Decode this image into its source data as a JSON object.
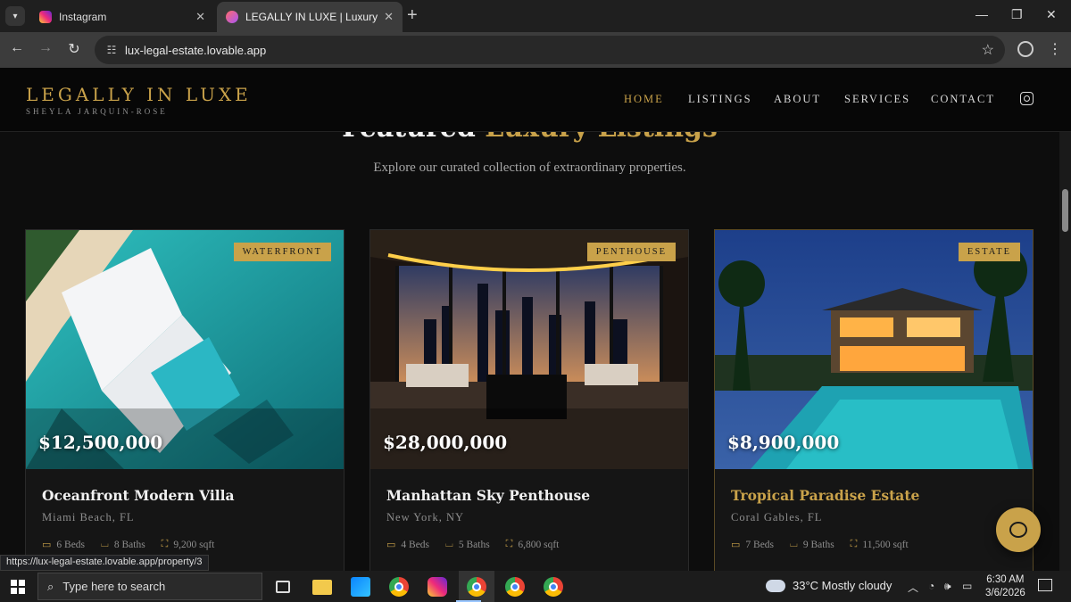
{
  "browser": {
    "tabs": [
      {
        "title": "Instagram",
        "active": false
      },
      {
        "title": "LEGALLY IN LUXE | Luxury Real I",
        "active": true
      }
    ],
    "url": "lux-legal-estate.lovable.app",
    "status_url": "https://lux-legal-estate.lovable.app/property/3"
  },
  "site": {
    "brand_title": "LEGALLY IN LUXE",
    "brand_subtitle": "SHEYLA JARQUIN-ROSE",
    "nav": [
      "HOME",
      "LISTINGS",
      "ABOUT",
      "SERVICES",
      "CONTACT"
    ],
    "active_nav": "HOME",
    "accent_color": "#c9a24a"
  },
  "section": {
    "title_main": "Featured",
    "title_accent": "Luxury Listings",
    "subtitle": "Explore our curated collection of extraordinary properties."
  },
  "listings": [
    {
      "badge": "WATERFRONT",
      "price": "$12,500,000",
      "name": "Oceanfront Modern Villa",
      "location": "Miami Beach, FL",
      "beds": "6 Beds",
      "baths": "8 Baths",
      "sqft": "9,200 sqft"
    },
    {
      "badge": "PENTHOUSE",
      "price": "$28,000,000",
      "name": "Manhattan Sky Penthouse",
      "location": "New York, NY",
      "beds": "4 Beds",
      "baths": "5 Baths",
      "sqft": "6,800 sqft"
    },
    {
      "badge": "ESTATE",
      "price": "$8,900,000",
      "name": "Tropical Paradise Estate",
      "location": "Coral Gables, FL",
      "beds": "7 Beds",
      "baths": "9 Baths",
      "sqft": "11,500 sqft"
    }
  ],
  "taskbar": {
    "search_placeholder": "Type here to search",
    "weather": "33°C  Mostly cloudy",
    "time": "6:30 AM",
    "date": "3/6/2026"
  }
}
